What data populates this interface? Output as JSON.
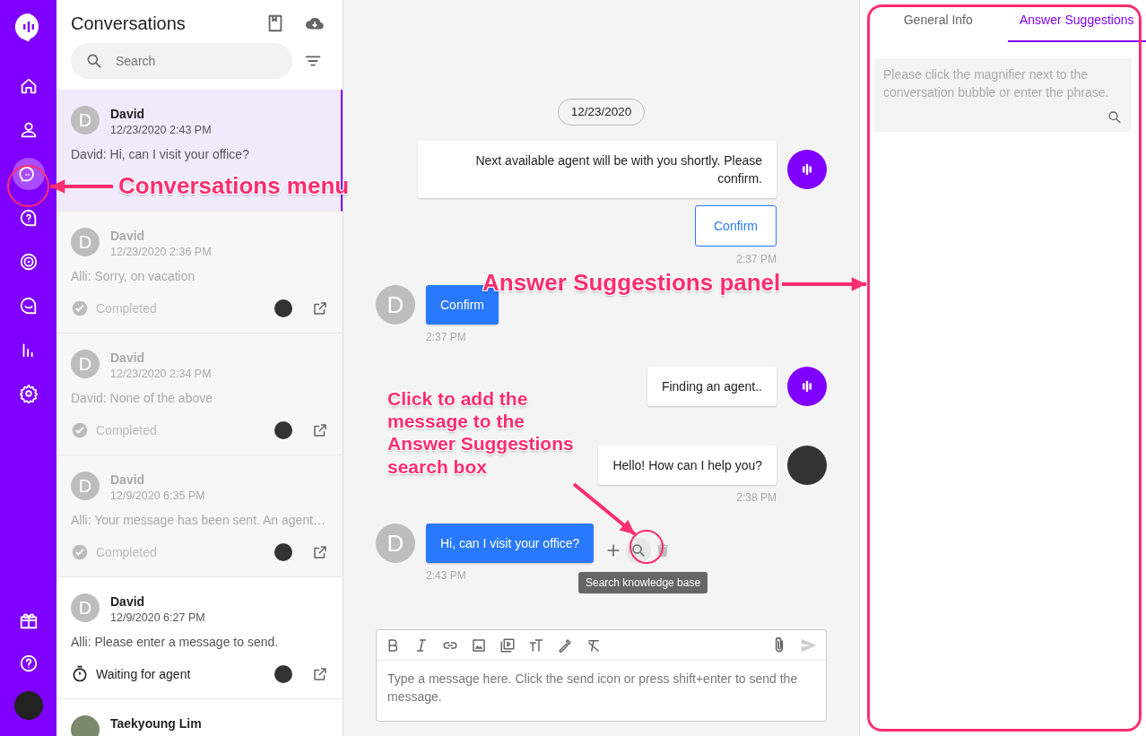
{
  "nav_items": [
    {
      "selected": false
    },
    {
      "selected": false
    },
    {
      "selected": true
    },
    {
      "selected": false
    },
    {
      "selected": false
    },
    {
      "selected": false
    },
    {
      "selected": false
    },
    {
      "selected": false
    }
  ],
  "conversations": {
    "title": "Conversations",
    "search": {
      "placeholder": "Search"
    },
    "items": [
      {
        "avatar": {
          "kind": "letter",
          "letter": "D"
        },
        "name": "David",
        "time": "12/23/2020 2:43 PM",
        "preview": "David: Hi, can I visit your office?",
        "selected": true,
        "muted": false
      },
      {
        "avatar": {
          "kind": "letter",
          "letter": "D"
        },
        "name": "David",
        "time": "12/23/2020 2:36 PM",
        "preview": "Alli: Sorry, on vacation",
        "status": {
          "kind": "completed",
          "label": "Completed"
        },
        "selected": false,
        "muted": true
      },
      {
        "avatar": {
          "kind": "letter",
          "letter": "D"
        },
        "name": "David",
        "time": "12/23/2020 2:34 PM",
        "preview": "David: None of the above",
        "status": {
          "kind": "completed",
          "label": "Completed"
        },
        "selected": false,
        "muted": true
      },
      {
        "avatar": {
          "kind": "letter",
          "letter": "D"
        },
        "name": "David",
        "time": "12/9/2020 6:35 PM",
        "preview": "Alli: Your message has been sent. An agent…",
        "status": {
          "kind": "completed",
          "label": "Completed"
        },
        "selected": false,
        "muted": true
      },
      {
        "avatar": {
          "kind": "letter",
          "letter": "D"
        },
        "name": "David",
        "time": "12/9/2020 6:27 PM",
        "preview": "Alli: Please enter a message to send.",
        "status": {
          "kind": "waiting",
          "label": "Waiting for agent"
        },
        "selected": false,
        "muted": false
      },
      {
        "avatar": {
          "kind": "photo"
        },
        "name": "Taekyoung Lim",
        "selected": false,
        "muted": false
      }
    ]
  },
  "chat": {
    "date": "12/23/2020",
    "messages": [
      {
        "kind": "bot",
        "text": "Next available agent will be with you shortly. Please confirm.",
        "buttons": [
          "Confirm"
        ],
        "time": "2:37 PM"
      },
      {
        "kind": "user",
        "avatar": "D",
        "text": "Confirm",
        "time": "2:37 PM"
      },
      {
        "kind": "bot",
        "text": "Finding an agent.."
      },
      {
        "kind": "agent",
        "text": "Hello! How can I help you?",
        "time": "2:38 PM"
      },
      {
        "kind": "user",
        "avatar": "D",
        "text": "Hi, can I visit your office?",
        "time": "2:43 PM",
        "tooltip": "Search knowledge base"
      }
    ],
    "composer": {
      "placeholder": "Type a message here. Click the send icon or press shift+enter to send the message."
    }
  },
  "panel": {
    "tabs": [
      {
        "label": "General Info",
        "selected": false
      },
      {
        "label": "Answer Suggestions",
        "selected": true
      }
    ],
    "search": {
      "placeholder": "Please click the magnifier next to the conversation bubble or enter the phrase."
    }
  },
  "annotations": [
    {
      "kind": "sidebar",
      "text": "Conversations menu"
    },
    {
      "kind": "panel",
      "text": "Answer Suggestions panel"
    },
    {
      "kind": "search",
      "text": "Click to add the message to the Answer Suggestions search box"
    }
  ]
}
